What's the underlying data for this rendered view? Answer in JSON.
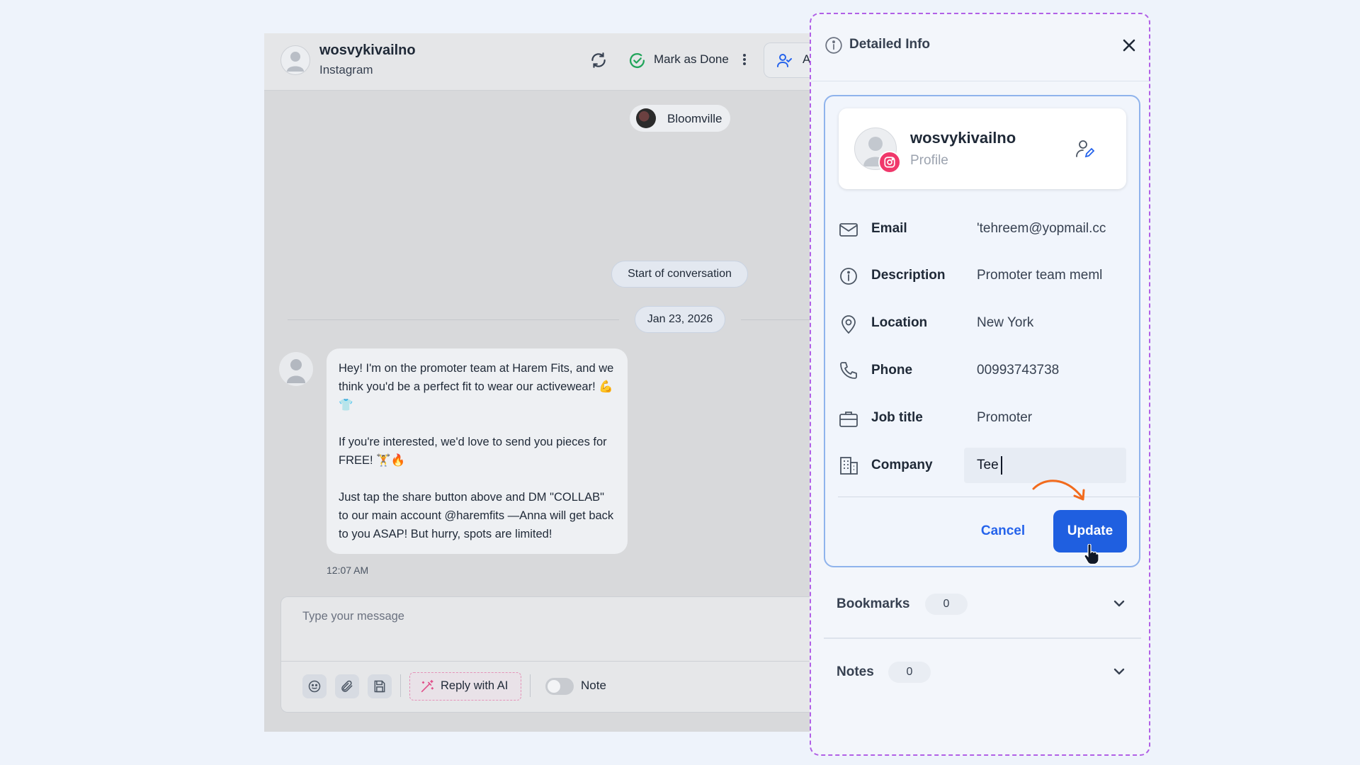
{
  "chat": {
    "contact_name": "wosvykivailno",
    "channel": "Instagram",
    "mark_done_label": "Mark as Done",
    "assign_label_partial": "A",
    "brand_name": "Bloomville",
    "start_label": "Start of conversation",
    "date_label": "Jan 23, 2026",
    "message": {
      "paragraph_1": "Hey! I'm on the promoter team at Harem Fits, and we think you'd be a perfect fit to wear our activewear! 💪👕",
      "paragraph_2": "If you're interested, we'd love to send you  pieces for FREE! 🏋🔥",
      "paragraph_3": "Just tap the share button above and DM \"COLLAB\" to our main account @haremfits —Anna will get back to you ASAP! But hurry, spots are limited!",
      "time": "12:07 AM"
    },
    "composer": {
      "placeholder": "Type your message",
      "reply_ai_label": "Reply with AI",
      "note_label": "Note",
      "note_enabled": false
    }
  },
  "panel": {
    "title": "Detailed Info",
    "profile": {
      "name": "wosvykivailno",
      "subtitle": "Profile",
      "platform_icon": "instagram-icon"
    },
    "fields": [
      {
        "label": "Email",
        "value": "'tehreem@yopmail.cc",
        "icon": "mail-icon"
      },
      {
        "label": "Description",
        "value": "Promoter team meml",
        "icon": "info-icon"
      },
      {
        "label": "Location",
        "value": "New York",
        "icon": "location-pin-icon"
      },
      {
        "label": "Phone",
        "value": "00993743738",
        "icon": "phone-icon"
      },
      {
        "label": "Job title",
        "value": "Promoter",
        "icon": "briefcase-icon"
      },
      {
        "label": "Company",
        "value": "Tee",
        "icon": "building-icon"
      }
    ],
    "cancel_label": "Cancel",
    "update_label": "Update",
    "bookmarks": {
      "label": "Bookmarks",
      "count": "0"
    },
    "notes": {
      "label": "Notes",
      "count": "0"
    }
  },
  "colors": {
    "accent": "#1f5fe0",
    "panel_border": "#b160e6",
    "annotation_arrow": "#f26b1d",
    "instagram": "#f0386b",
    "done_green": "#22a55b"
  }
}
